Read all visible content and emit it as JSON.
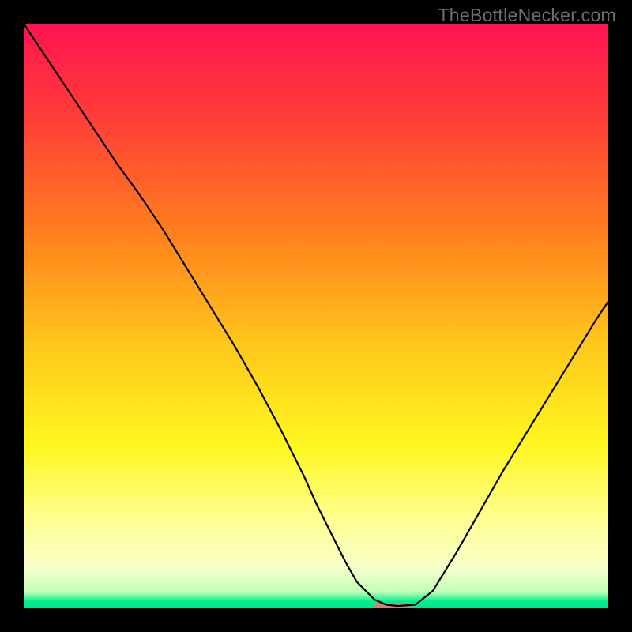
{
  "watermark": "TheBottleNecker.com",
  "chart_data": {
    "type": "line",
    "title": "",
    "xlabel": "",
    "ylabel": "",
    "xlim": [
      0,
      100
    ],
    "ylim": [
      0,
      100
    ],
    "grid": false,
    "background_gradient": {
      "stops": [
        {
          "offset": 0.0,
          "color": "#ff1452"
        },
        {
          "offset": 0.15,
          "color": "#ff3a39"
        },
        {
          "offset": 0.35,
          "color": "#ff7d1e"
        },
        {
          "offset": 0.55,
          "color": "#ffc81b"
        },
        {
          "offset": 0.72,
          "color": "#fff71e"
        },
        {
          "offset": 0.85,
          "color": "#ffff92"
        },
        {
          "offset": 0.93,
          "color": "#f7ffca"
        },
        {
          "offset": 0.972,
          "color": "#c1ffb7"
        },
        {
          "offset": 0.988,
          "color": "#00f08f"
        },
        {
          "offset": 1.0,
          "color": "#00e38e"
        }
      ]
    },
    "series": [
      {
        "name": "bottleneck-curve",
        "stroke": "#000000",
        "x": [
          0.0,
          4.0,
          8.0,
          12.0,
          16.0,
          20.0,
          24.0,
          28.0,
          32.0,
          36.0,
          40.0,
          44.0,
          48.0,
          50.0,
          53.0,
          55.0,
          57.0,
          60.0,
          62.0,
          64.0,
          67.0,
          70.0,
          74.0,
          78.0,
          82.0,
          86.0,
          90.0,
          94.0,
          98.0,
          100.0
        ],
        "y": [
          100.0,
          94.0,
          88.0,
          82.0,
          76.0,
          70.5,
          64.5,
          58.0,
          51.5,
          45.0,
          38.0,
          30.5,
          22.5,
          18.0,
          12.0,
          8.0,
          4.5,
          1.5,
          0.6,
          0.4,
          0.6,
          3.0,
          9.5,
          16.5,
          23.5,
          30.0,
          36.5,
          43.0,
          49.5,
          52.5
        ]
      }
    ],
    "marker": {
      "name": "optimal-marker",
      "x": 63.0,
      "width": 6.0,
      "y": 0.3,
      "color": "#d97f7b"
    }
  }
}
